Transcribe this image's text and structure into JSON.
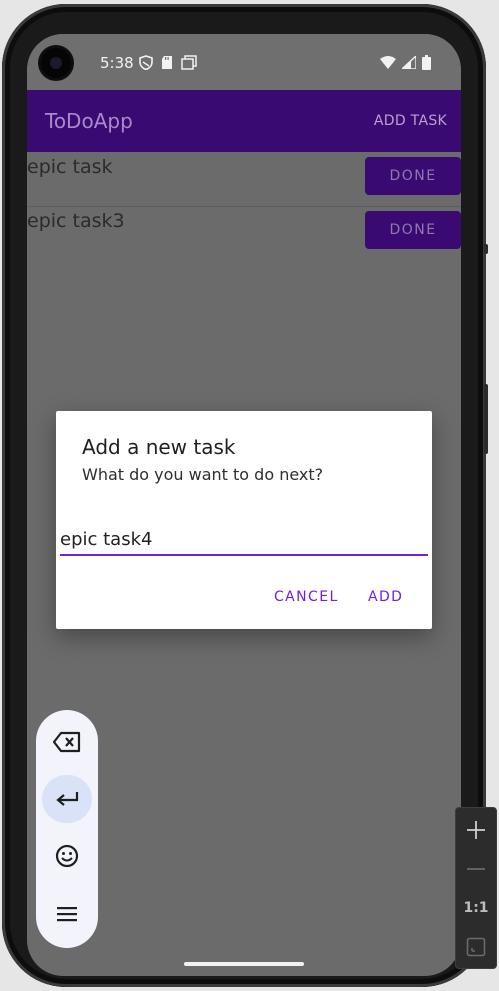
{
  "status_bar": {
    "time": "5:38"
  },
  "app": {
    "title": "ToDoApp",
    "add_task_label": "ADD TASK"
  },
  "tasks": [
    {
      "text": "epic task",
      "action": "DONE"
    },
    {
      "text": "epic task3",
      "action": "DONE"
    }
  ],
  "dialog": {
    "title": "Add a new task",
    "message": "What do you want to do next?",
    "input_value": "epic task4",
    "cancel_label": "CANCEL",
    "add_label": "ADD"
  },
  "keyboard_toolbar": {
    "icons": [
      "backspace-icon",
      "enter-icon",
      "emoji-icon",
      "menu-icon"
    ]
  },
  "zoom_controls": {
    "ratio_label": "1:1"
  },
  "colors": {
    "appbar": "#3a0a73",
    "accent": "#6e22d8",
    "scrim_bg": "#6b6b6b"
  }
}
